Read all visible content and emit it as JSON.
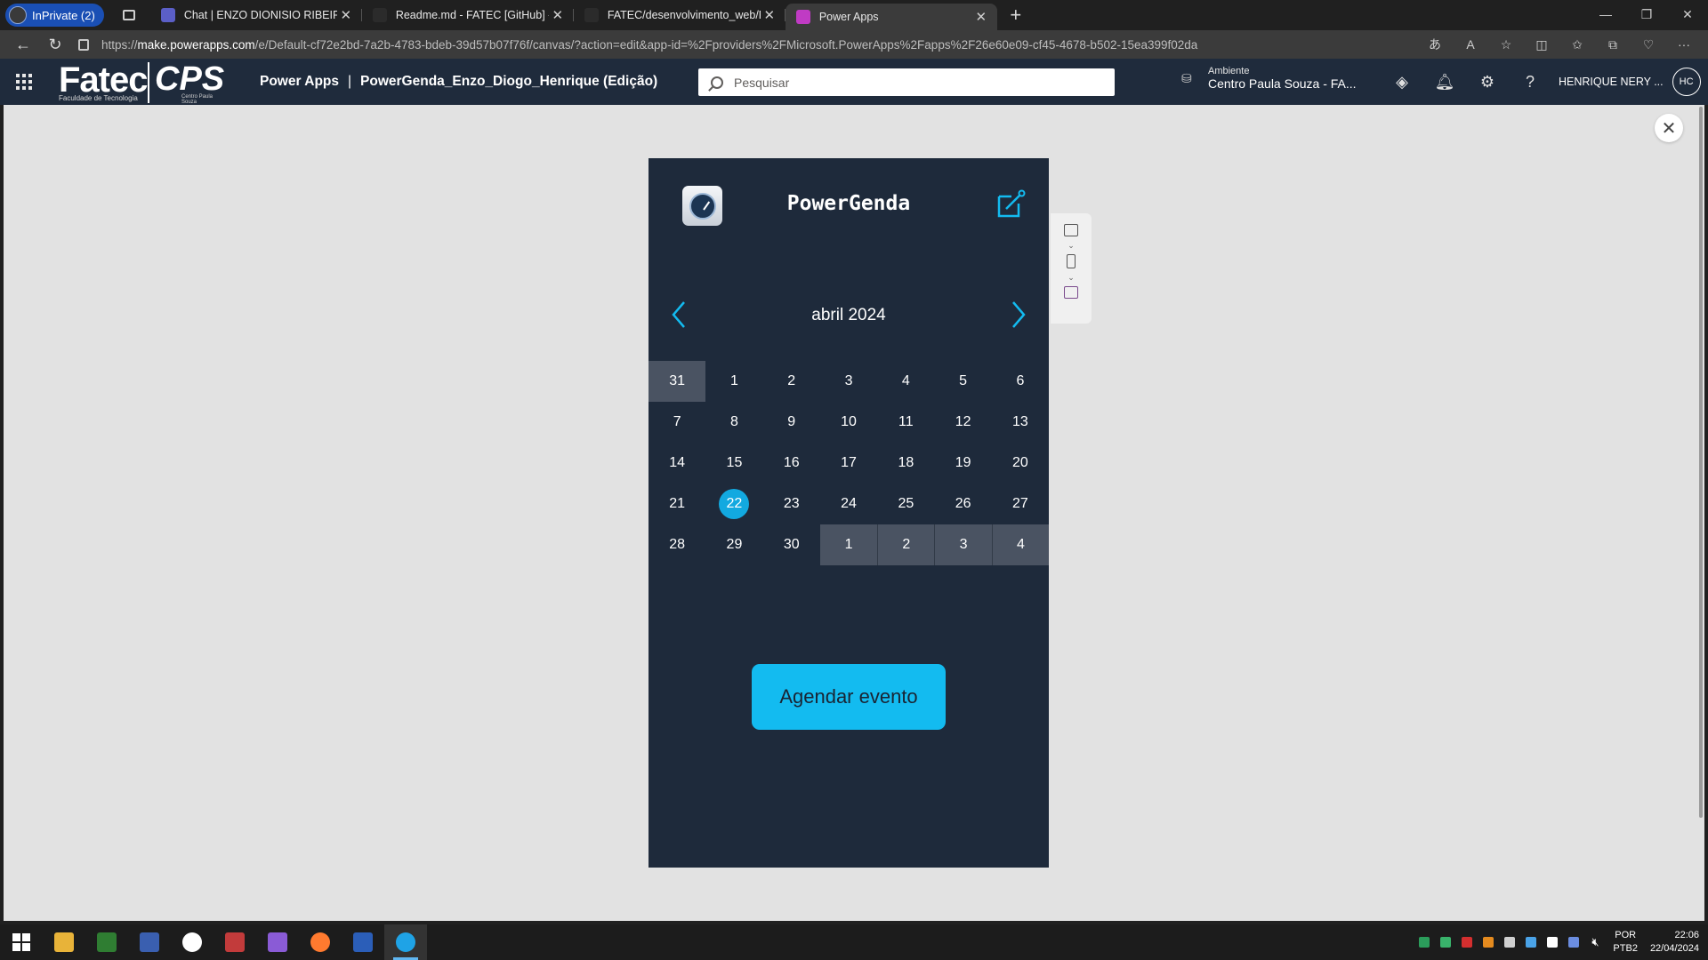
{
  "browser": {
    "inprivate_label": "InPrivate (2)",
    "tabs": [
      {
        "title": "Chat | ENZO DIONISIO RIBEIRO | Microsoft Teams",
        "favicon_color": "#5b5fc7"
      },
      {
        "title": "Readme.md - FATEC [GitHub] - Visual Studio Code",
        "favicon_color": "#2b2b2b"
      },
      {
        "title": "FATEC/desenvolvimento_web/PowerGenda",
        "favicon_color": "#2b2b2b"
      },
      {
        "title": "Power Apps",
        "favicon_color": "#c03bc4"
      }
    ],
    "url_prefix": "https://",
    "url_domain": "make.powerapps.com",
    "url_path": "/e/Default-cf72e2bd-7a2b-4783-bdeb-39d57b07f76f/canvas/?action=edit&app-id=%2Fproviders%2FMicrosoft.PowerApps%2Fapps%2F26e60e09-cf45-4678-b502-15ea399f02da"
  },
  "header": {
    "logo_text": "Fatec",
    "logo_sub": "Faculdade de Tecnologia",
    "logo2_text": "CPS",
    "logo2_sub": "Centro Paula Souza",
    "product": "Power Apps",
    "separator": "|",
    "app_title": "PowerGenda_Enzo_Diogo_Henrique (Edição)",
    "search_placeholder": "Pesquisar",
    "env_label": "Ambiente",
    "env_name": "Centro Paula Souza - FA...",
    "user_name": "HENRIQUE NERY ...",
    "user_initials": "HC"
  },
  "app": {
    "name": "PowerGenda",
    "month_label": "abril 2024",
    "days": [
      {
        "n": "31",
        "other": true
      },
      {
        "n": "1"
      },
      {
        "n": "2"
      },
      {
        "n": "3"
      },
      {
        "n": "4"
      },
      {
        "n": "5"
      },
      {
        "n": "6"
      },
      {
        "n": "7"
      },
      {
        "n": "8"
      },
      {
        "n": "9"
      },
      {
        "n": "10"
      },
      {
        "n": "11"
      },
      {
        "n": "12"
      },
      {
        "n": "13"
      },
      {
        "n": "14"
      },
      {
        "n": "15"
      },
      {
        "n": "16"
      },
      {
        "n": "17"
      },
      {
        "n": "18"
      },
      {
        "n": "19"
      },
      {
        "n": "20"
      },
      {
        "n": "21"
      },
      {
        "n": "22",
        "today": true
      },
      {
        "n": "23"
      },
      {
        "n": "24"
      },
      {
        "n": "25"
      },
      {
        "n": "26"
      },
      {
        "n": "27"
      },
      {
        "n": "28"
      },
      {
        "n": "29"
      },
      {
        "n": "30"
      },
      {
        "n": "1",
        "other": true
      },
      {
        "n": "2",
        "other": true
      },
      {
        "n": "3",
        "other": true
      },
      {
        "n": "4",
        "other": true
      }
    ],
    "button_label": "Agendar evento",
    "accent": "#13bbf0",
    "background": "#1e2a3b"
  },
  "taskbar": {
    "apps": [
      {
        "name": "file-explorer",
        "color": "#e8b339"
      },
      {
        "name": "project",
        "color": "#2f7d32"
      },
      {
        "name": "visio",
        "color": "#3a5fb0"
      },
      {
        "name": "app-w",
        "color": "#ffffff"
      },
      {
        "name": "access",
        "color": "#c23b3b"
      },
      {
        "name": "visual-studio",
        "color": "#8a5bd6"
      },
      {
        "name": "firefox",
        "color": "#ff7a2f"
      },
      {
        "name": "word",
        "color": "#2b5eb8"
      },
      {
        "name": "edge",
        "color": "#1fa3e6"
      }
    ],
    "lang_1": "POR",
    "lang_2": "PTB2",
    "time": "22:06",
    "date": "22/04/2024"
  }
}
